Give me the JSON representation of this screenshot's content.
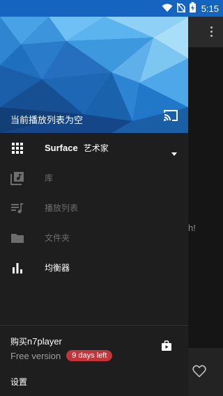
{
  "status_bar": {
    "time": "5:15",
    "icons": [
      "wifi-icon",
      "no-sim-icon",
      "battery-charging-icon"
    ]
  },
  "drawer": {
    "header": {
      "now_playing_text": "当前播放列表为空",
      "cast_icon": "cast-icon"
    },
    "menu": {
      "surface": {
        "name": "Surface",
        "sub": "艺术家",
        "icon": "grid-icon"
      },
      "items": [
        {
          "label": "库",
          "icon": "library-icon",
          "enabled": false
        },
        {
          "label": "播放列表",
          "icon": "playlist-icon",
          "enabled": false
        },
        {
          "label": "文件夹",
          "icon": "folder-icon",
          "enabled": false
        },
        {
          "label": "均衡器",
          "icon": "equalizer-icon",
          "enabled": true
        }
      ]
    },
    "footer": {
      "buy_prefix": "购买",
      "buy_app": "n7player",
      "version": "Free version",
      "trial_badge": "9 days left",
      "settings": "设置"
    }
  },
  "background_app": {
    "visible_text": "h!"
  },
  "colors": {
    "accent": "#1565c0",
    "badge": "#c2353b",
    "drawer_bg": "#1e1e1e"
  }
}
